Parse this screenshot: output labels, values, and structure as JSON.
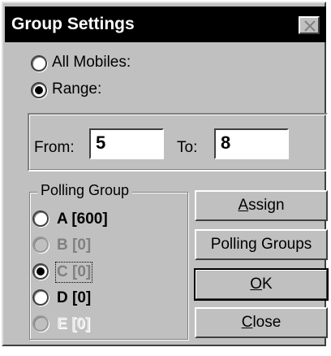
{
  "window": {
    "title": "Group Settings",
    "close_icon": "close-icon"
  },
  "mode": {
    "all_mobiles_label": "All Mobiles:",
    "range_label": "Range:",
    "selected": "range"
  },
  "range": {
    "from_label": "From:",
    "from_value": "5",
    "to_label": "To:",
    "to_value": "8"
  },
  "polling_group": {
    "legend": "Polling Group",
    "options": [
      {
        "letter": "A",
        "value": "[600]",
        "selected": false,
        "state": "enabled"
      },
      {
        "letter": "B",
        "value": "[0]",
        "selected": false,
        "state": "disabled"
      },
      {
        "letter": "C",
        "value": "[0]",
        "selected": true,
        "state": "disabled"
      },
      {
        "letter": "D",
        "value": "[0]",
        "selected": false,
        "state": "enabled"
      },
      {
        "letter": "E",
        "value": "[0]",
        "selected": false,
        "state": "disabled"
      }
    ]
  },
  "buttons": {
    "assign_label": "Assign",
    "assign_mnemonic": "A",
    "assign_rest": "ssign",
    "polling_groups_label": "Polling Groups",
    "ok_label": "OK",
    "ok_mnemonic": "O",
    "ok_rest": "K",
    "close_label": "Close",
    "close_mnemonic": "C",
    "close_rest": "lose"
  },
  "colors": {
    "face": "#c0c0c0",
    "title_bg": "#000000",
    "title_fg": "#ffffff",
    "disabled_text": "#808080"
  }
}
